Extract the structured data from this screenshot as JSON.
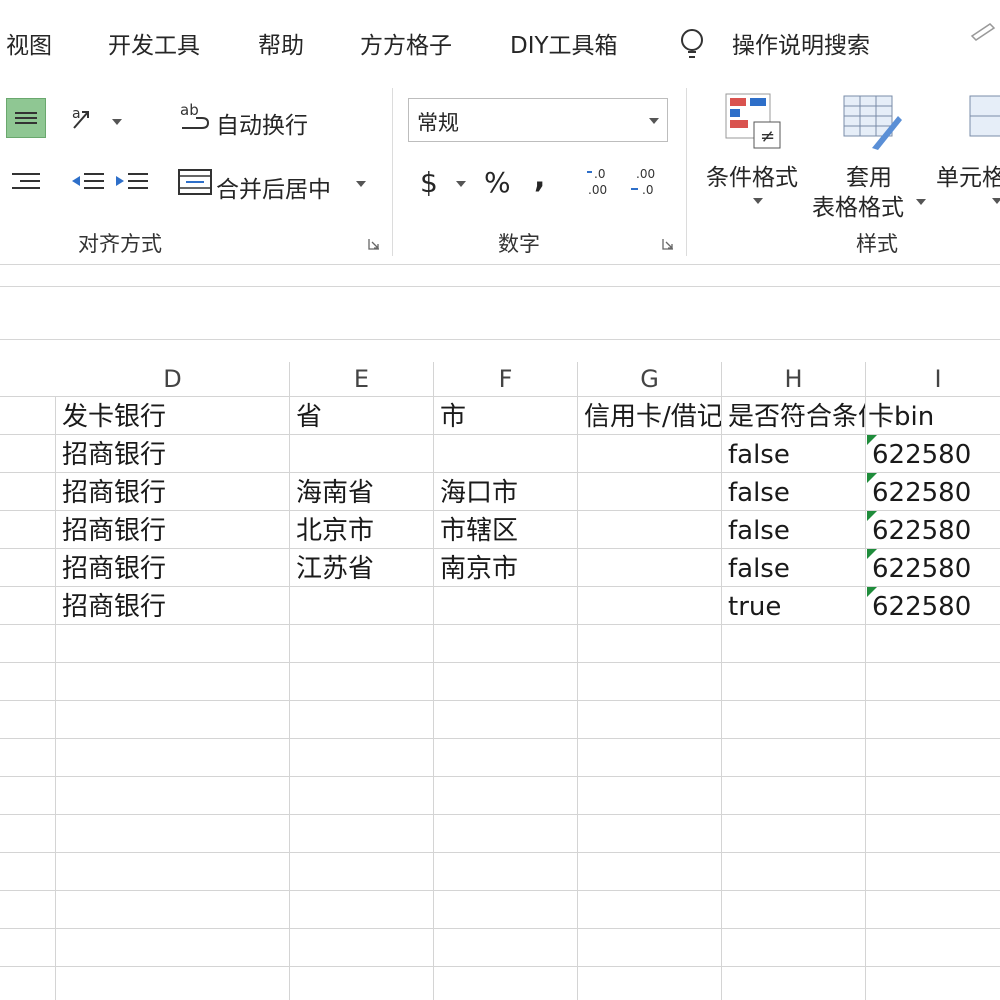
{
  "menu": {
    "tabs": [
      "视图",
      "开发工具",
      "帮助",
      "方方格子",
      "DIY工具箱"
    ],
    "tell_me": "操作说明搜索"
  },
  "ribbon": {
    "alignment": {
      "wrap_text": "自动换行",
      "merge_center": "合并后居中",
      "group_label": "对齐方式"
    },
    "number": {
      "format_value": "常规",
      "currency": "$",
      "percent": "%",
      "comma": ",",
      "group_label": "数字"
    },
    "styles": {
      "conditional": "条件格式",
      "table_line1": "套用",
      "table_line2": "表格格式",
      "cell_styles": "单元格",
      "group_label": "样式"
    }
  },
  "sheet": {
    "columns": [
      "D",
      "E",
      "F",
      "G",
      "H",
      "I"
    ],
    "rows": [
      [
        "发卡银行",
        "省",
        "市",
        "信用卡/借记",
        "是否符合条件",
        "卡bin"
      ],
      [
        "招商银行",
        "",
        "",
        "",
        "false",
        "622580"
      ],
      [
        "招商银行",
        "海南省",
        "海口市",
        "",
        "false",
        "622580"
      ],
      [
        "招商银行",
        "北京市",
        "市辖区",
        "",
        "false",
        "622580"
      ],
      [
        "招商银行",
        "江苏省",
        "南京市",
        "",
        "false",
        "622580"
      ],
      [
        "招商银行",
        "",
        "",
        "",
        "true",
        "622580"
      ]
    ]
  },
  "colors": {
    "accent_green": "#1f8c3b",
    "active_button": "#8fc793"
  }
}
